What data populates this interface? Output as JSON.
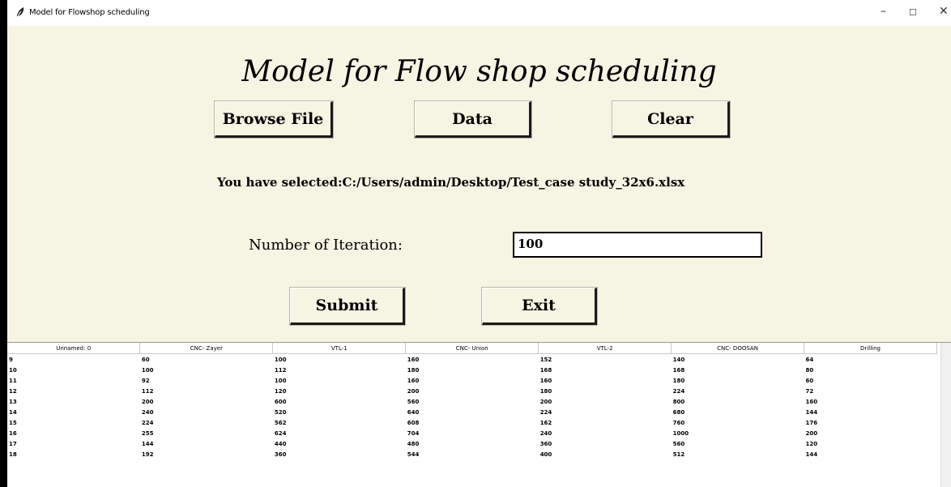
{
  "window": {
    "title": "Model for Flowshop scheduling",
    "controls": {
      "minimize": "–",
      "maximize": "☐",
      "close": "✕"
    }
  },
  "app": {
    "heading": "Model for Flow shop scheduling",
    "buttons": {
      "browse": "Browse File",
      "data": "Data",
      "clear": "Clear",
      "submit": "Submit",
      "exit": "Exit"
    },
    "selected_file_text": "You have selected:C:/Users/admin/Desktop/Test_case study_32x6.xlsx",
    "iteration": {
      "label": "Number of Iteration:",
      "value": "100"
    }
  },
  "table": {
    "columns": [
      "Unnamed: 0",
      "CNC- Zayer",
      "VTL-1",
      "CNC- Union",
      "VTL-2",
      "CNC- DOOSAN",
      "Drilling"
    ],
    "rows": [
      [
        "9",
        "60",
        "100",
        "160",
        "152",
        "140",
        "64"
      ],
      [
        "10",
        "100",
        "112",
        "180",
        "168",
        "168",
        "80"
      ],
      [
        "11",
        "92",
        "100",
        "160",
        "160",
        "180",
        "60"
      ],
      [
        "12",
        "112",
        "120",
        "200",
        "180",
        "224",
        "72"
      ],
      [
        "13",
        "200",
        "600",
        "560",
        "200",
        "800",
        "160"
      ],
      [
        "14",
        "240",
        "520",
        "640",
        "224",
        "680",
        "144"
      ],
      [
        "15",
        "224",
        "562",
        "608",
        "162",
        "760",
        "176"
      ],
      [
        "16",
        "255",
        "624",
        "704",
        "240",
        "1000",
        "200"
      ],
      [
        "17",
        "144",
        "440",
        "480",
        "360",
        "560",
        "120"
      ],
      [
        "18",
        "192",
        "360",
        "544",
        "400",
        "512",
        "144"
      ]
    ]
  }
}
